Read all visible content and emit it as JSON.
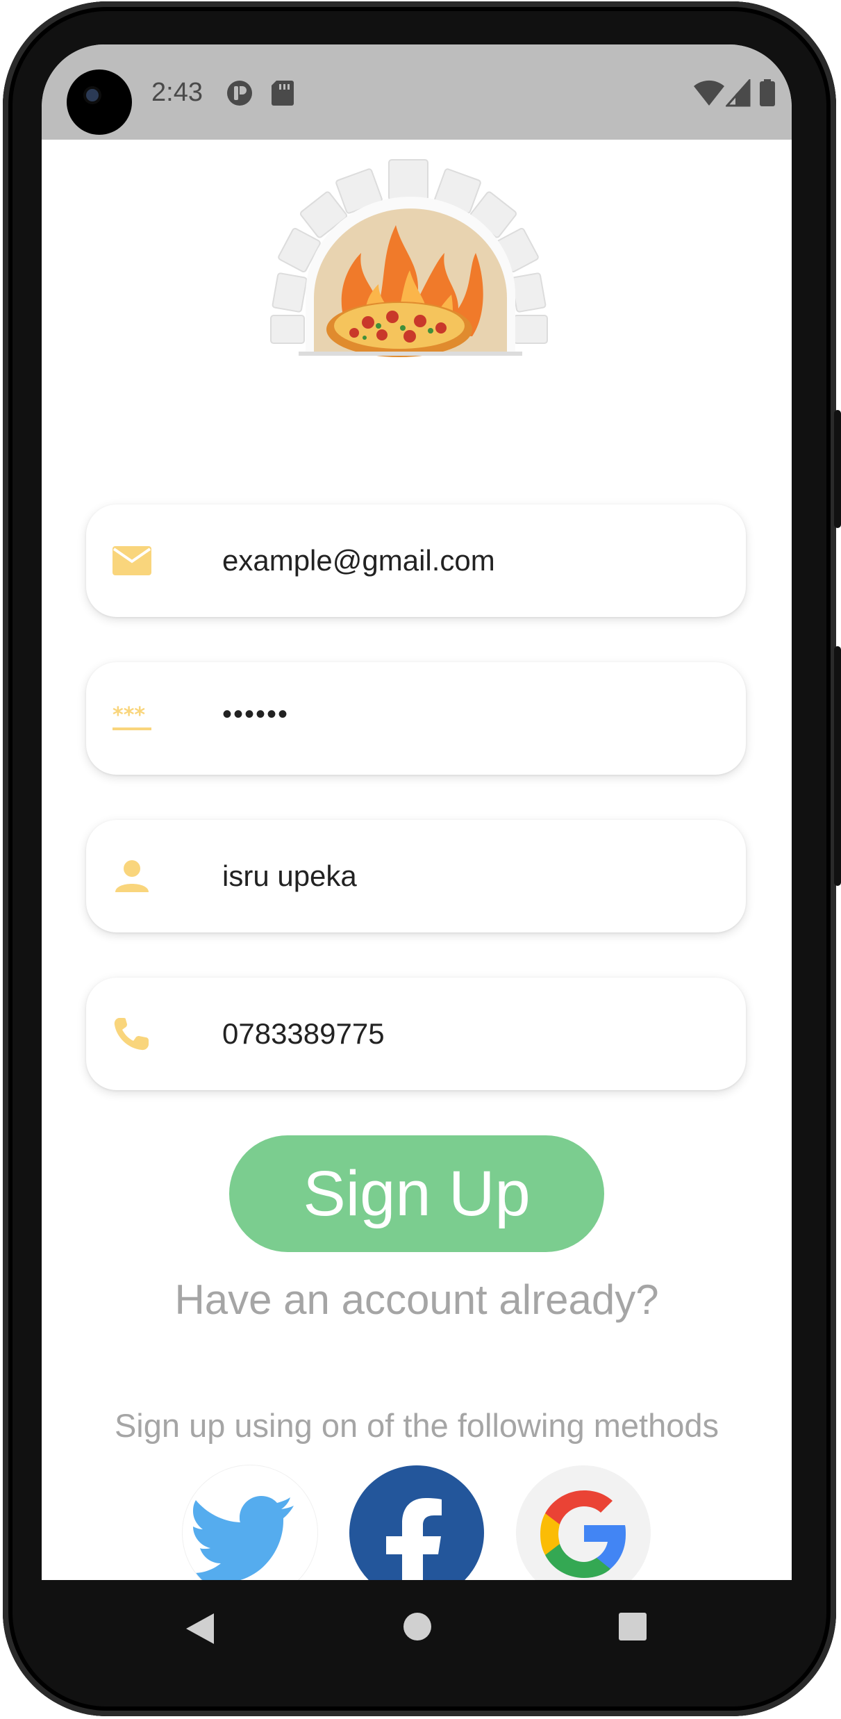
{
  "status_bar": {
    "time": "2:43"
  },
  "form": {
    "email": "example@gmail.com",
    "password": "••••••",
    "name": "isru upeka",
    "phone": "0783389775"
  },
  "actions": {
    "signup_label": "Sign Up",
    "have_account": "Have an account already?",
    "methods_text": "Sign up using on of the following methods"
  },
  "social": [
    "twitter",
    "facebook",
    "google"
  ],
  "colors": {
    "accent_yellow": "#f9d57c",
    "signup_green": "#7bcd8f",
    "twitter_blue": "#55acee",
    "facebook_blue": "#23569b",
    "muted_text": "#a5a5a5",
    "status_bar": "#bdbdbd"
  }
}
